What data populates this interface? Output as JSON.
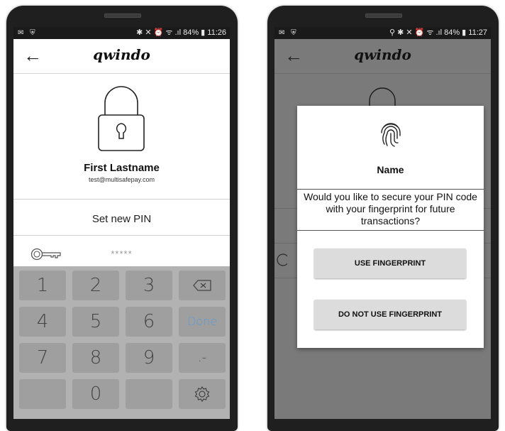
{
  "left_phone": {
    "status": {
      "left_icons": "✉ ⛨",
      "right": "✱ ✕ ⏰ ᯤ .ıl 84% ▮ 11:26"
    },
    "appbar": {
      "brand": "qwindo",
      "back_icon": "arrow-left-icon"
    },
    "user": {
      "name": "First Lastname",
      "email": "test@multisafepay.com"
    },
    "pin": {
      "title": "Set new PIN",
      "masked_value": "*****"
    },
    "keypad": {
      "keys": [
        "1",
        "2",
        "3",
        "⌫",
        "4",
        "5",
        "6",
        "Done",
        "7",
        "8",
        "9",
        ".-",
        "",
        "0",
        "",
        "⚙"
      ]
    }
  },
  "right_phone": {
    "status": {
      "left_icons": "✉ ⛨",
      "right": "⚲ ✱ ✕ ⏰ ᯤ .ıl 84% ▮ 11:27"
    },
    "appbar": {
      "brand": "qwindo",
      "back_icon": "arrow-left-icon"
    },
    "dialog": {
      "icon": "fingerprint-icon",
      "title": "Name",
      "message": "Would you like to secure your PIN code with your fingerprint for future transactions?",
      "use_button": "USE FINGERPRINT",
      "dont_use_button": "DO NOT USE FINGERPRINT"
    }
  },
  "colors": {
    "done_key": "#5b9bd5",
    "keypad_bg": "#b2b2b2",
    "key_bg": "#9f9f9f",
    "overlay": "#7a7a7a"
  }
}
